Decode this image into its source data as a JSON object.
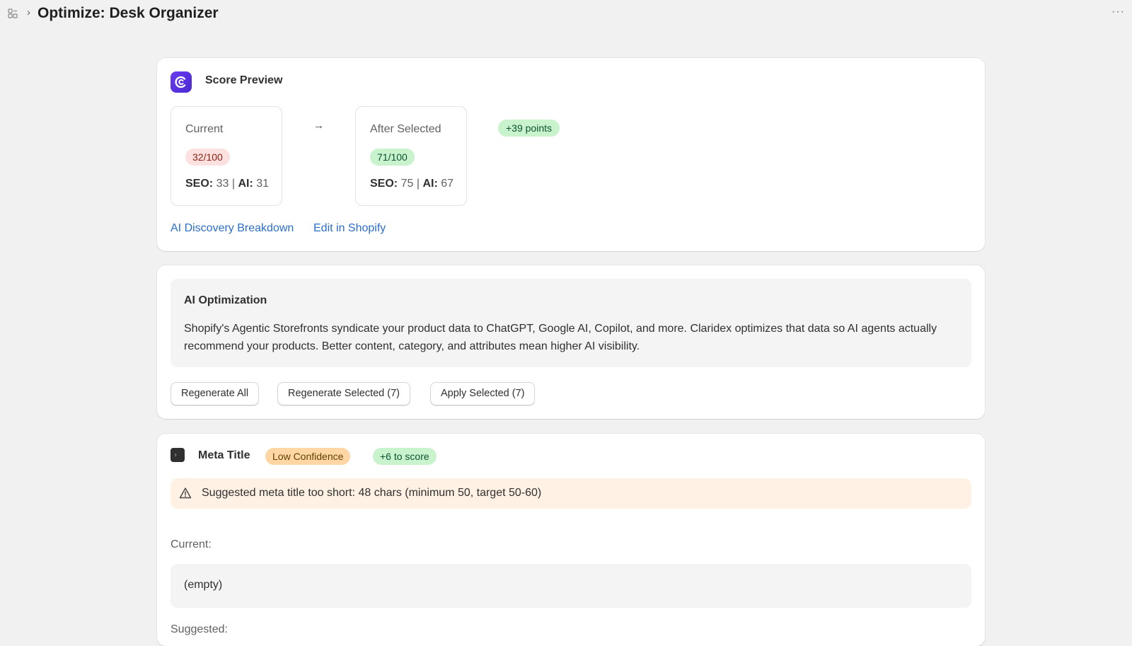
{
  "header": {
    "title": "Optimize: Desk Organizer",
    "breadcrumb_separator": "›",
    "more_label": "···"
  },
  "score_preview": {
    "title": "Score Preview",
    "arrow": "→",
    "current": {
      "label": "Current",
      "score": "32/100",
      "seo_label": "SEO:",
      "seo_value": "33",
      "ai_label": "AI:",
      "ai_value": "31"
    },
    "after": {
      "label": "After Selected",
      "score": "71/100",
      "seo_label": "SEO:",
      "seo_value": "75",
      "ai_label": "AI:",
      "ai_value": "67"
    },
    "gain": "+39 points",
    "links": {
      "breakdown": "AI Discovery Breakdown",
      "edit": "Edit in Shopify"
    }
  },
  "ai_optimization": {
    "title": "AI Optimization",
    "description": "Shopify's Agentic Storefronts syndicate your product data to ChatGPT, Google AI, Copilot, and more. Claridex optimizes that data so AI agents actually recommend your products. Better content, category, and attributes mean higher AI visibility.",
    "buttons": {
      "regenerate_all": "Regenerate All",
      "regenerate_selected": "Regenerate Selected (7)",
      "apply_selected": "Apply Selected (7)"
    }
  },
  "meta_title": {
    "title": "Meta Title",
    "confidence": "Low Confidence",
    "score_gain": "+6 to score",
    "warning": "Suggested meta title too short: 48 chars (minimum 50, target 50-60)",
    "current_label": "Current:",
    "current_value": "(empty)",
    "suggested_label": "Suggested:"
  },
  "icons": {
    "app": "app-grid-icon",
    "logo": "claridex-logo-icon",
    "meta": "terminal-icon",
    "warning": "warning-triangle-icon",
    "more": "more-horizontal-icon"
  },
  "colors": {
    "background": "#f1f1f1",
    "link": "#2c6ecb",
    "danger_pill": "#fde1e1",
    "success_pill": "#c8f3cd",
    "warning_pill": "#ffd6a4",
    "warning_banner": "#fff1e3",
    "brand": "#5a34e6"
  }
}
